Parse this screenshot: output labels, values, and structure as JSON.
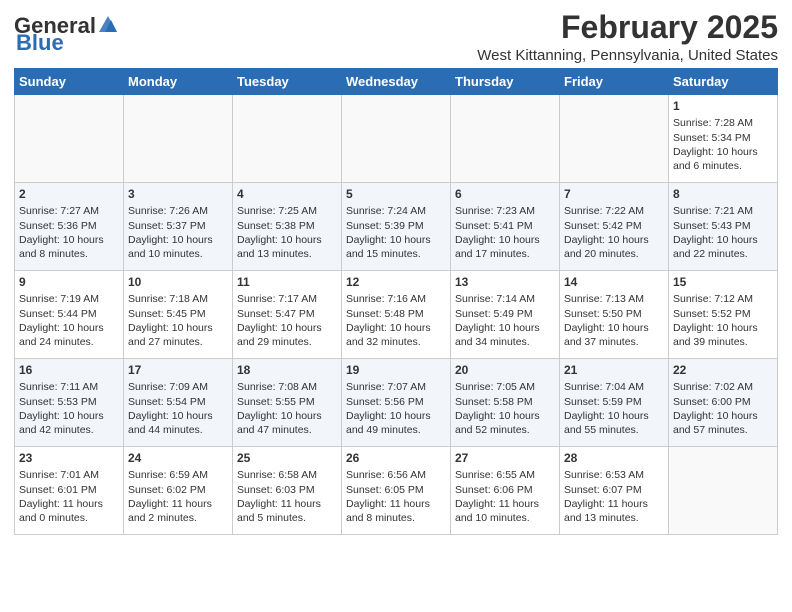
{
  "header": {
    "logo_general": "General",
    "logo_blue": "Blue",
    "main_title": "February 2025",
    "sub_title": "West Kittanning, Pennsylvania, United States"
  },
  "days_of_week": [
    "Sunday",
    "Monday",
    "Tuesday",
    "Wednesday",
    "Thursday",
    "Friday",
    "Saturday"
  ],
  "weeks": [
    [
      {
        "day": "",
        "info": ""
      },
      {
        "day": "",
        "info": ""
      },
      {
        "day": "",
        "info": ""
      },
      {
        "day": "",
        "info": ""
      },
      {
        "day": "",
        "info": ""
      },
      {
        "day": "",
        "info": ""
      },
      {
        "day": "1",
        "info": "Sunrise: 7:28 AM\nSunset: 5:34 PM\nDaylight: 10 hours and 6 minutes."
      }
    ],
    [
      {
        "day": "2",
        "info": "Sunrise: 7:27 AM\nSunset: 5:36 PM\nDaylight: 10 hours and 8 minutes."
      },
      {
        "day": "3",
        "info": "Sunrise: 7:26 AM\nSunset: 5:37 PM\nDaylight: 10 hours and 10 minutes."
      },
      {
        "day": "4",
        "info": "Sunrise: 7:25 AM\nSunset: 5:38 PM\nDaylight: 10 hours and 13 minutes."
      },
      {
        "day": "5",
        "info": "Sunrise: 7:24 AM\nSunset: 5:39 PM\nDaylight: 10 hours and 15 minutes."
      },
      {
        "day": "6",
        "info": "Sunrise: 7:23 AM\nSunset: 5:41 PM\nDaylight: 10 hours and 17 minutes."
      },
      {
        "day": "7",
        "info": "Sunrise: 7:22 AM\nSunset: 5:42 PM\nDaylight: 10 hours and 20 minutes."
      },
      {
        "day": "8",
        "info": "Sunrise: 7:21 AM\nSunset: 5:43 PM\nDaylight: 10 hours and 22 minutes."
      }
    ],
    [
      {
        "day": "9",
        "info": "Sunrise: 7:19 AM\nSunset: 5:44 PM\nDaylight: 10 hours and 24 minutes."
      },
      {
        "day": "10",
        "info": "Sunrise: 7:18 AM\nSunset: 5:45 PM\nDaylight: 10 hours and 27 minutes."
      },
      {
        "day": "11",
        "info": "Sunrise: 7:17 AM\nSunset: 5:47 PM\nDaylight: 10 hours and 29 minutes."
      },
      {
        "day": "12",
        "info": "Sunrise: 7:16 AM\nSunset: 5:48 PM\nDaylight: 10 hours and 32 minutes."
      },
      {
        "day": "13",
        "info": "Sunrise: 7:14 AM\nSunset: 5:49 PM\nDaylight: 10 hours and 34 minutes."
      },
      {
        "day": "14",
        "info": "Sunrise: 7:13 AM\nSunset: 5:50 PM\nDaylight: 10 hours and 37 minutes."
      },
      {
        "day": "15",
        "info": "Sunrise: 7:12 AM\nSunset: 5:52 PM\nDaylight: 10 hours and 39 minutes."
      }
    ],
    [
      {
        "day": "16",
        "info": "Sunrise: 7:11 AM\nSunset: 5:53 PM\nDaylight: 10 hours and 42 minutes."
      },
      {
        "day": "17",
        "info": "Sunrise: 7:09 AM\nSunset: 5:54 PM\nDaylight: 10 hours and 44 minutes."
      },
      {
        "day": "18",
        "info": "Sunrise: 7:08 AM\nSunset: 5:55 PM\nDaylight: 10 hours and 47 minutes."
      },
      {
        "day": "19",
        "info": "Sunrise: 7:07 AM\nSunset: 5:56 PM\nDaylight: 10 hours and 49 minutes."
      },
      {
        "day": "20",
        "info": "Sunrise: 7:05 AM\nSunset: 5:58 PM\nDaylight: 10 hours and 52 minutes."
      },
      {
        "day": "21",
        "info": "Sunrise: 7:04 AM\nSunset: 5:59 PM\nDaylight: 10 hours and 55 minutes."
      },
      {
        "day": "22",
        "info": "Sunrise: 7:02 AM\nSunset: 6:00 PM\nDaylight: 10 hours and 57 minutes."
      }
    ],
    [
      {
        "day": "23",
        "info": "Sunrise: 7:01 AM\nSunset: 6:01 PM\nDaylight: 11 hours and 0 minutes."
      },
      {
        "day": "24",
        "info": "Sunrise: 6:59 AM\nSunset: 6:02 PM\nDaylight: 11 hours and 2 minutes."
      },
      {
        "day": "25",
        "info": "Sunrise: 6:58 AM\nSunset: 6:03 PM\nDaylight: 11 hours and 5 minutes."
      },
      {
        "day": "26",
        "info": "Sunrise: 6:56 AM\nSunset: 6:05 PM\nDaylight: 11 hours and 8 minutes."
      },
      {
        "day": "27",
        "info": "Sunrise: 6:55 AM\nSunset: 6:06 PM\nDaylight: 11 hours and 10 minutes."
      },
      {
        "day": "28",
        "info": "Sunrise: 6:53 AM\nSunset: 6:07 PM\nDaylight: 11 hours and 13 minutes."
      },
      {
        "day": "",
        "info": ""
      }
    ]
  ]
}
